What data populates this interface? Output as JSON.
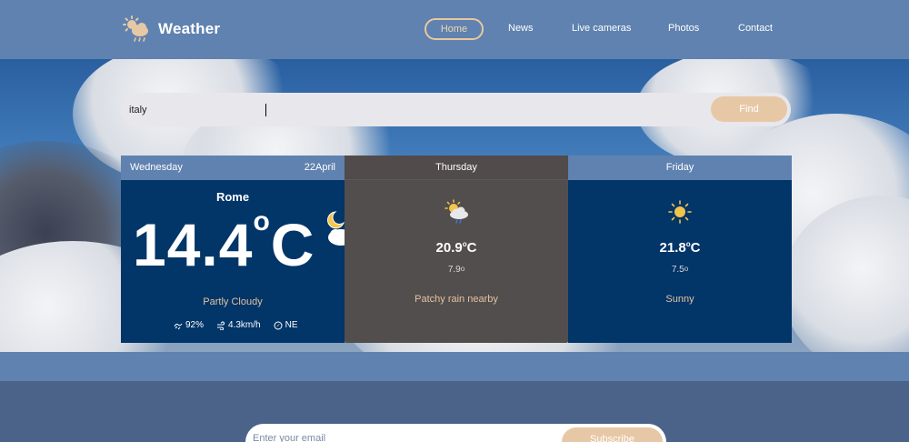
{
  "header": {
    "logo_text": "Weather",
    "nav": [
      {
        "label": "Home",
        "active": true
      },
      {
        "label": "News"
      },
      {
        "label": "Live cameras"
      },
      {
        "label": "Photos"
      },
      {
        "label": "Contact"
      }
    ]
  },
  "search": {
    "value": "italy",
    "button": "Find"
  },
  "today": {
    "day": "Wednesday",
    "date": "22April",
    "city": "Rome",
    "temp": "14.4",
    "unit": "C",
    "condition": "Partly Cloudy",
    "humidity": "92%",
    "wind": "4.3km/h",
    "direction": "NE",
    "icon": "moon-cloud-icon"
  },
  "forecast": [
    {
      "day": "Thursday",
      "max": "20.9",
      "unit": "C",
      "min": "7.9",
      "condition": "Patchy rain nearby",
      "icon": "sun-cloud-rain-icon"
    },
    {
      "day": "Friday",
      "max": "21.8",
      "unit": "C",
      "min": "7.5",
      "condition": "Sunny",
      "icon": "sun-icon"
    }
  ],
  "subscribe": {
    "placeholder": "Enter your email",
    "button": "Subscribe"
  },
  "colors": {
    "accent": "#e7c8a6",
    "header": "#5f82b0",
    "card": "#023568",
    "card_highlight": "#524e4e"
  }
}
